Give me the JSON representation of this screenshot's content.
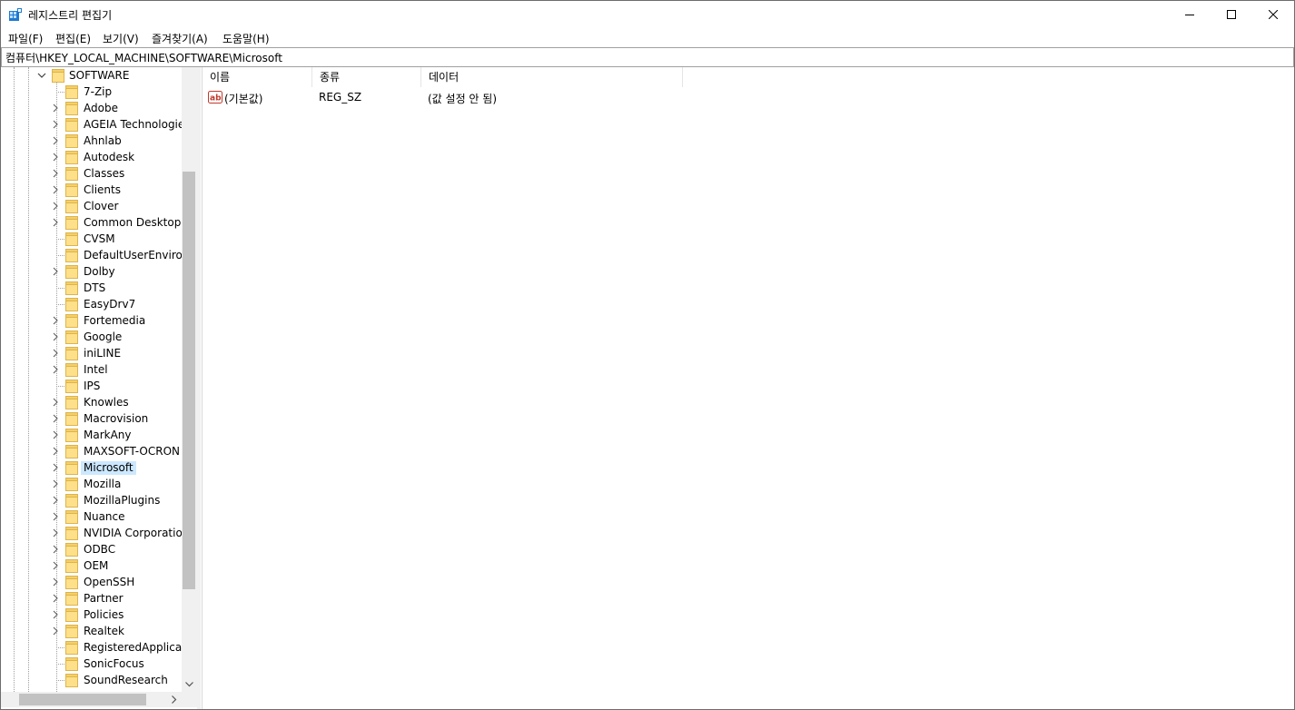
{
  "window": {
    "title": "레지스트리 편집기"
  },
  "menu": [
    {
      "label": "파일(F)"
    },
    {
      "label": "편집(E)"
    },
    {
      "label": "보기(V)"
    },
    {
      "label": "즐겨찾기(A)"
    },
    {
      "label": "도움말(H)"
    }
  ],
  "address": {
    "path": "컴퓨터\\HKEY_LOCAL_MACHINE\\SOFTWARE\\Microsoft"
  },
  "tree": {
    "root": {
      "label": "SOFTWARE"
    },
    "items": [
      {
        "label": "7-Zip",
        "has_children": false
      },
      {
        "label": "Adobe",
        "has_children": true
      },
      {
        "label": "AGEIA Technologies",
        "has_children": true
      },
      {
        "label": "Ahnlab",
        "has_children": true
      },
      {
        "label": "Autodesk",
        "has_children": true
      },
      {
        "label": "Classes",
        "has_children": true
      },
      {
        "label": "Clients",
        "has_children": true
      },
      {
        "label": "Clover",
        "has_children": true
      },
      {
        "label": "Common Desktop A",
        "has_children": true
      },
      {
        "label": "CVSM",
        "has_children": false
      },
      {
        "label": "DefaultUserEnvironn",
        "has_children": false
      },
      {
        "label": "Dolby",
        "has_children": true
      },
      {
        "label": "DTS",
        "has_children": false
      },
      {
        "label": "EasyDrv7",
        "has_children": false
      },
      {
        "label": "Fortemedia",
        "has_children": true
      },
      {
        "label": "Google",
        "has_children": true
      },
      {
        "label": "iniLINE",
        "has_children": true
      },
      {
        "label": "Intel",
        "has_children": true
      },
      {
        "label": "IPS",
        "has_children": false
      },
      {
        "label": "Knowles",
        "has_children": true
      },
      {
        "label": "Macrovision",
        "has_children": true
      },
      {
        "label": "MarkAny",
        "has_children": true
      },
      {
        "label": "MAXSOFT-OCRON",
        "has_children": true
      },
      {
        "label": "Microsoft",
        "has_children": true,
        "selected": true
      },
      {
        "label": "Mozilla",
        "has_children": true
      },
      {
        "label": "MozillaPlugins",
        "has_children": true
      },
      {
        "label": "Nuance",
        "has_children": true
      },
      {
        "label": "NVIDIA Corporation",
        "has_children": true
      },
      {
        "label": "ODBC",
        "has_children": true
      },
      {
        "label": "OEM",
        "has_children": true
      },
      {
        "label": "OpenSSH",
        "has_children": true
      },
      {
        "label": "Partner",
        "has_children": true
      },
      {
        "label": "Policies",
        "has_children": true
      },
      {
        "label": "Realtek",
        "has_children": true
      },
      {
        "label": "RegisteredApplicatio",
        "has_children": false
      },
      {
        "label": "SonicFocus",
        "has_children": false
      },
      {
        "label": "SoundResearch",
        "has_children": false
      }
    ]
  },
  "values": {
    "columns": {
      "name": "이름",
      "type": "종류",
      "data": "데이터"
    },
    "rows": [
      {
        "name": "(기본값)",
        "type": "REG_SZ",
        "data": "(값 설정 안 됨)",
        "icon": "string-value-icon"
      }
    ]
  },
  "colors": {
    "selection": "#cce8ff",
    "folder": "#ffe08a",
    "folder_edge": "#dcb44a",
    "value_icon": "#c0392b"
  }
}
